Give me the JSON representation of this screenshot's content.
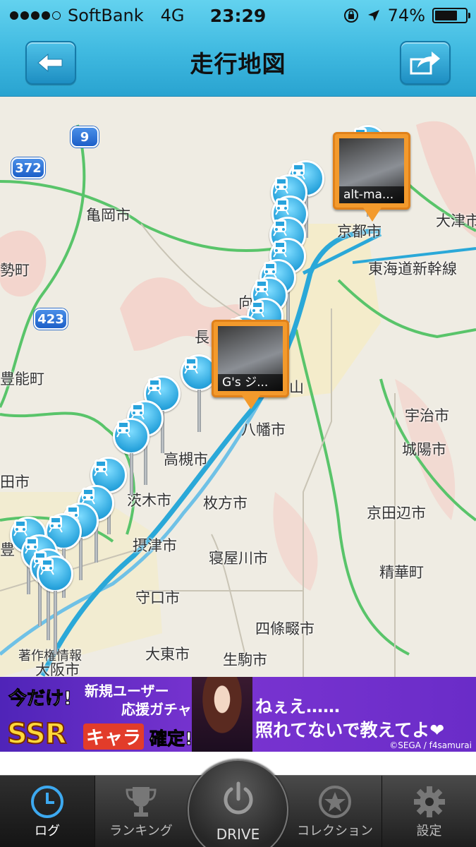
{
  "status_bar": {
    "carrier": "SoftBank",
    "network": "4G",
    "time": "23:29",
    "battery": "74%",
    "battery_level": 0.74
  },
  "header": {
    "title": "走行地図",
    "back_icon": "arrow-left-icon",
    "share_icon": "share-arrow-icon"
  },
  "map": {
    "labels": {
      "kameoka": "亀岡市",
      "otsu": "大津市",
      "kyoto": "京都市",
      "tokaido": "東海道新幹線",
      "nose": "勢町",
      "toyono": "豊能町",
      "naga": "長",
      "mukou": "向",
      "yamashina": "山",
      "yawata": "八幡市",
      "uji": "宇治市",
      "joyo": "城陽市",
      "takatsuki": "高槻市",
      "ibaraki": "茨木市",
      "hirakata": "枚方市",
      "kyotanabe": "京田辺市",
      "settsu": "摂津市",
      "neyagawa": "寝屋川市",
      "seika": "精華町",
      "moriguchi": "守口市",
      "shijonawate": "四條畷市",
      "daito": "大東市",
      "ikoma": "生駒市",
      "osaka": "大阪市",
      "chosakuken": "著作権情報",
      "ta": "田市",
      "toyo": "豊"
    },
    "route_shields": [
      "9",
      "372",
      "423"
    ],
    "photo_pins": [
      {
        "caption": "alt-ma..."
      },
      {
        "caption": "G's ジ..."
      }
    ]
  },
  "banner": {
    "line1": "今だけ!",
    "line2": "新規ユーザー",
    "line3": "応援ガチャ",
    "ssr": "SSR",
    "chara": "キャラ",
    "confirm": "確定!",
    "quote1": "ねぇえ……",
    "quote2": "照れてないで教えてよ❤",
    "copyright": "©SEGA / f4samurai"
  },
  "tabbar": {
    "tabs": [
      {
        "label": "ログ",
        "icon": "clock-icon"
      },
      {
        "label": "ランキング",
        "icon": "trophy-icon"
      },
      {
        "label": "DRIVE",
        "icon": "power-icon"
      },
      {
        "label": "コレクション",
        "icon": "star-icon"
      },
      {
        "label": "設定",
        "icon": "gear-icon"
      }
    ]
  },
  "colors": {
    "header": "#3fb9e0",
    "route": "#2aa8d8",
    "pin": "#28a3dc",
    "photo_pin": "#f39a2c",
    "tab_active": "#3da9f0"
  }
}
